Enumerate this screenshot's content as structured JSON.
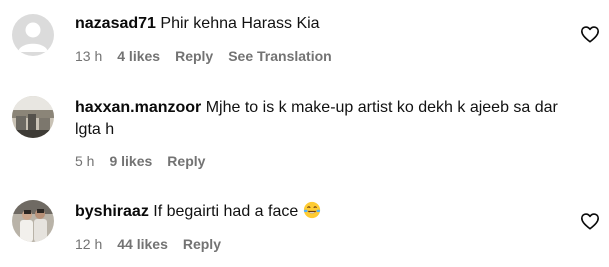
{
  "comments": [
    {
      "username": "nazasad71",
      "text": "Phir kehna Harass Kia",
      "time": "13 h",
      "likes": "4 likes",
      "reply": "Reply",
      "translation": "See Translation",
      "avatar": "default-avatar"
    },
    {
      "username": "haxxan.manzoor",
      "text": "Mjhe to is k make-up artist ko dekh k ajeeb sa dar lgta h",
      "time": "5 h",
      "likes": "9 likes",
      "reply": "Reply",
      "avatar": "photo-avatar"
    },
    {
      "username": "byshiraaz",
      "text": "If begairti had a face",
      "emoji": "laughing-tears-emoji",
      "time": "12 h",
      "likes": "44 likes",
      "reply": "Reply",
      "avatar": "photo-avatar"
    }
  ],
  "icons": {
    "like": "heart-outline-icon"
  },
  "colors": {
    "meta": "#737373",
    "text": "#0a0a0a",
    "background": "#ffffff"
  }
}
